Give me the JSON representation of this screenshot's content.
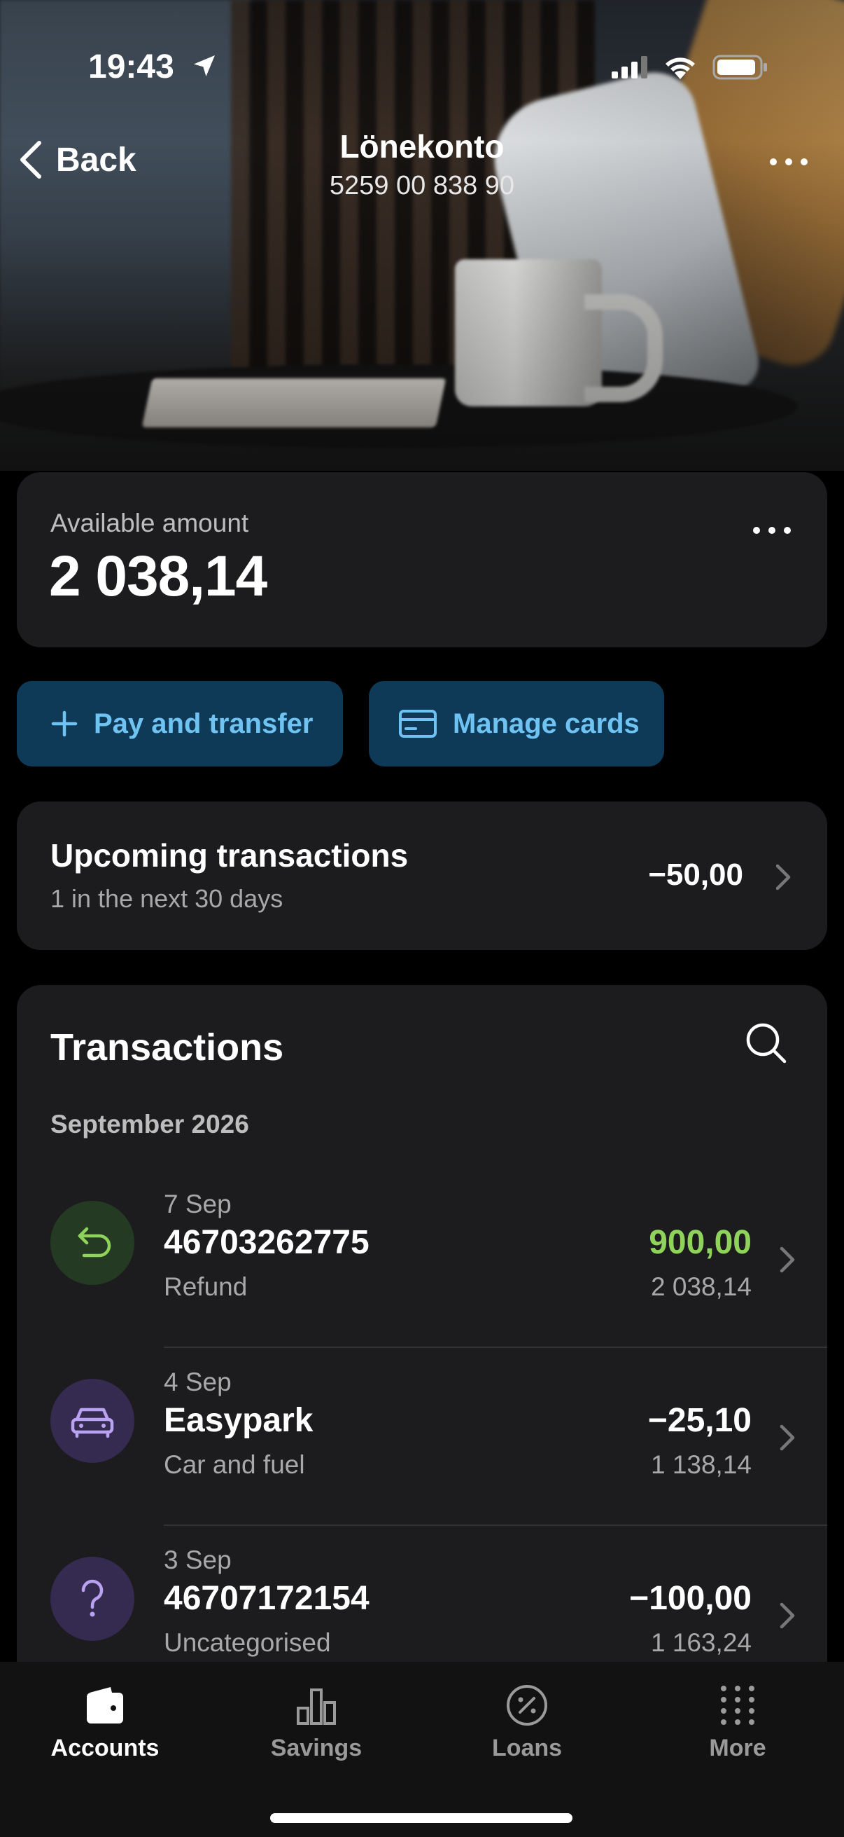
{
  "status_bar": {
    "time": "19:43"
  },
  "nav": {
    "back_label": "Back",
    "title": "Lönekonto",
    "account_number": "5259 00 838 90"
  },
  "balance": {
    "label": "Available amount",
    "value": "2 038,14"
  },
  "actions": {
    "pay_label": "Pay and transfer",
    "cards_label": "Manage cards"
  },
  "upcoming": {
    "title": "Upcoming transactions",
    "subtitle": "1 in the next 30 days",
    "amount": "−50,00"
  },
  "transactions": {
    "title": "Transactions",
    "month": "September 2026",
    "items": [
      {
        "date": "7 Sep",
        "name": "46703262775",
        "category": "Refund",
        "amount": "900,00",
        "balance": "2 038,14",
        "icon": "refund-arrow-icon",
        "amount_color": "#8fd35a",
        "icon_bg": "#253a22"
      },
      {
        "date": "4 Sep",
        "name": "Easypark",
        "category": "Car and fuel",
        "amount": "−25,10",
        "balance": "1 138,14",
        "icon": "car-icon",
        "amount_color": "#ffffff",
        "icon_bg": "#352a4f"
      },
      {
        "date": "3 Sep",
        "name": "46707172154",
        "category": "Uncategorised",
        "amount": "−100,00",
        "balance": "1 163,24",
        "icon": "question-mark-icon",
        "amount_color": "#ffffff",
        "icon_bg": "#352a4f"
      }
    ]
  },
  "tabbar": {
    "tabs": [
      {
        "label": "Accounts",
        "icon": "wallet-icon",
        "active": true
      },
      {
        "label": "Savings",
        "icon": "bar-chart-icon",
        "active": false
      },
      {
        "label": "Loans",
        "icon": "percent-circle-icon",
        "active": false
      },
      {
        "label": "More",
        "icon": "grid-dots-icon",
        "active": false
      }
    ]
  }
}
